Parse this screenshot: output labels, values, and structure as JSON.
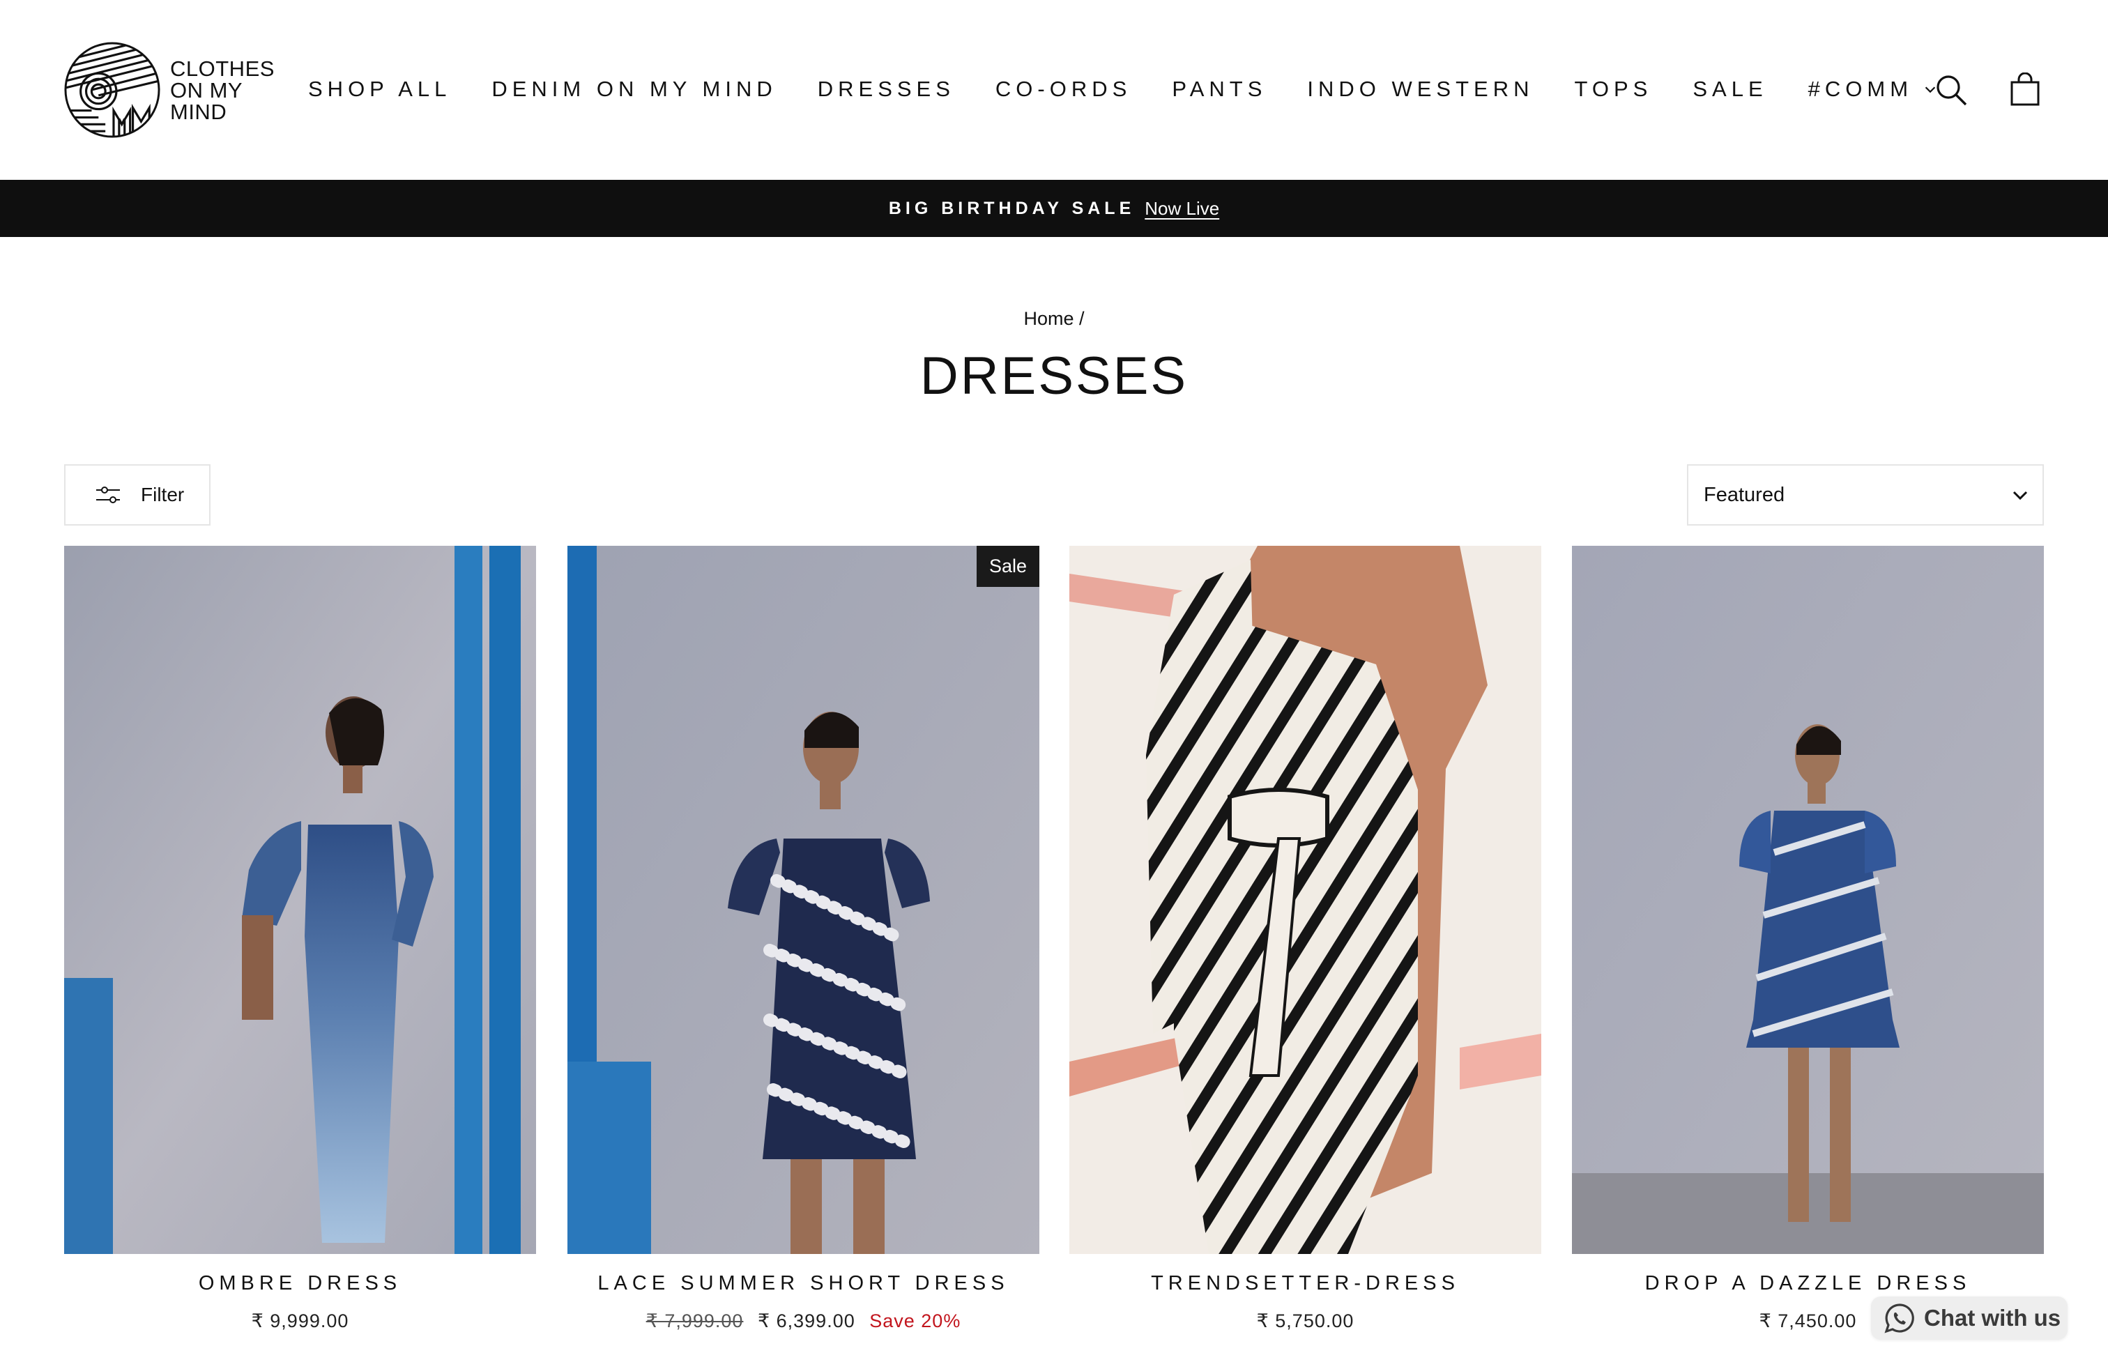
{
  "header": {
    "logo_lines": [
      "CLOTHES",
      "ON MY",
      "MIND"
    ],
    "nav": [
      {
        "label": "SHOP ALL"
      },
      {
        "label": "DENIM ON MY MIND"
      },
      {
        "label": "DRESSES"
      },
      {
        "label": "CO-ORDS"
      },
      {
        "label": "PANTS"
      },
      {
        "label": "INDO WESTERN"
      },
      {
        "label": "TOPS"
      },
      {
        "label": "SALE"
      },
      {
        "label": "#COMM"
      }
    ],
    "icons": {
      "search": "search-icon",
      "cart": "shopping-bag-icon"
    }
  },
  "announcement": {
    "strong": "BIG BIRTHDAY SALE",
    "link": "Now Live"
  },
  "breadcrumb": {
    "home": "Home",
    "separator": "/"
  },
  "collection": {
    "title": "DRESSES"
  },
  "controls": {
    "filter_label": "Filter",
    "sort_value": "Featured"
  },
  "products": [
    {
      "name": "OMBRE DRESS",
      "price": "₹ 9,999.00",
      "compare_price": "",
      "save": "",
      "badge": ""
    },
    {
      "name": "LACE SUMMER SHORT DRESS",
      "price": "₹ 6,399.00",
      "compare_price": "₹ 7,999.00",
      "save": "Save 20%",
      "badge": "Sale"
    },
    {
      "name": "TRENDSETTER-DRESS",
      "price": "₹ 5,750.00",
      "compare_price": "",
      "save": "",
      "badge": ""
    },
    {
      "name": "DROP A DAZZLE DRESS",
      "price": "₹ 7,450.00",
      "compare_price": "",
      "save": "",
      "badge": ""
    }
  ],
  "chat": {
    "label": "Chat with us",
    "icon": "whatsapp-icon"
  },
  "colors": {
    "announcement_bg": "#0f0f0f",
    "sale_text": "#c2151d",
    "badge_bg": "#1a1a1a",
    "chat_bg": "#eeeeee"
  }
}
